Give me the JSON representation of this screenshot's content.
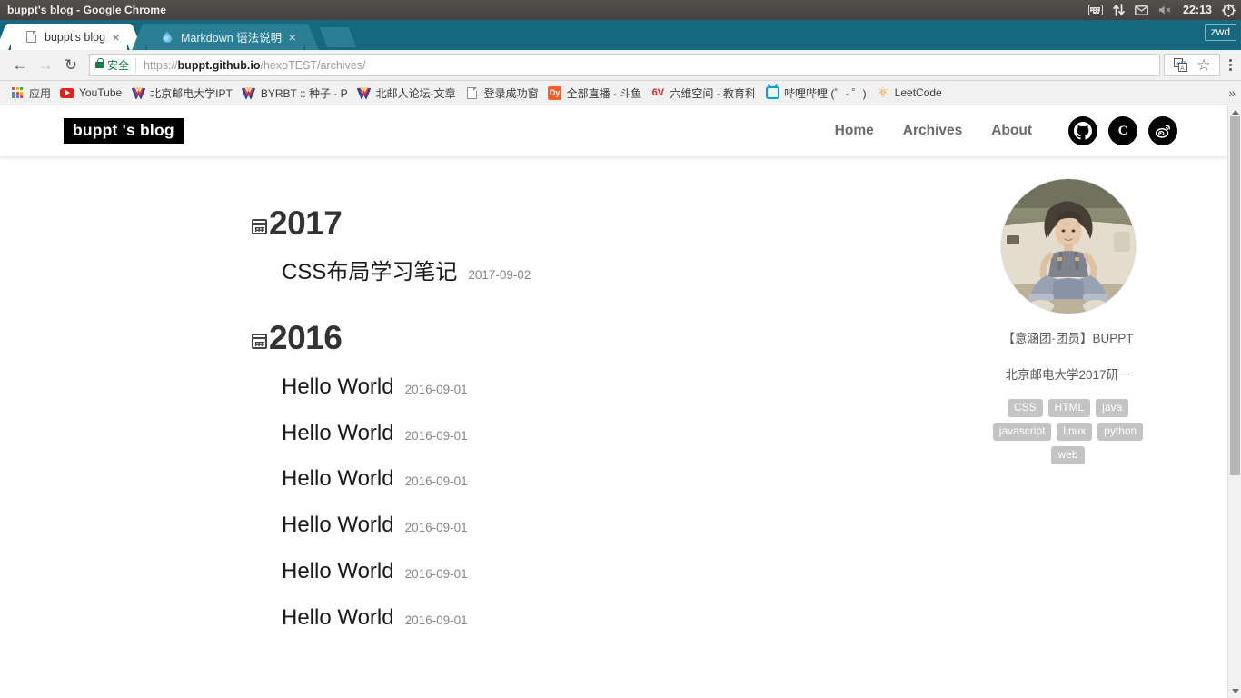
{
  "window": {
    "title": "buppt's blog - Google Chrome",
    "tray": {
      "keyboard_icon": "keyboard-icon",
      "network_icon": "network-updown-icon",
      "mail_icon": "mail-icon",
      "volume_icon": "volume-muted-icon",
      "clock": "22:13",
      "power_icon": "power-gear-icon"
    },
    "user_badge": "zwd"
  },
  "tabs": [
    {
      "title": "buppt's blog",
      "favicon": "page-icon",
      "active": true,
      "close_label": "×"
    },
    {
      "title": "Markdown 语法说明",
      "favicon": "water-drop-icon",
      "active": false,
      "close_label": "×"
    }
  ],
  "toolbar": {
    "back_icon": "←",
    "forward_icon": "→",
    "reload_icon": "↻",
    "security_label": "安全",
    "url": {
      "scheme": "https://",
      "host": "buppt.github.io",
      "path": "/hexoTEST/archives/",
      "full": "https://buppt.github.io/hexoTEST/archives/"
    },
    "translate_icon": "translate-icon",
    "bookmark_star": "☆",
    "menu_icon": "three-dot-menu-icon"
  },
  "bookmarks": {
    "items": [
      {
        "label": "应用",
        "icon": "apps-grid-icon"
      },
      {
        "label": "YouTube",
        "icon": "youtube-icon"
      },
      {
        "label": "北京邮电大学IPT",
        "icon": "v-bird-icon"
      },
      {
        "label": "BYRBT :: 种子 - P",
        "icon": "v-bird-icon"
      },
      {
        "label": "北邮人论坛-文章",
        "icon": "v-bird-icon"
      },
      {
        "label": "登录成功窗",
        "icon": "page-icon"
      },
      {
        "label": "全部直播 - 斗鱼",
        "icon": "douyu-icon"
      },
      {
        "label": "六维空间 - 教育科",
        "icon": "liuwei-icon"
      },
      {
        "label": "哔哩哔哩 (゜- ゜)",
        "icon": "bilibili-icon"
      },
      {
        "label": "LeetCode",
        "icon": "leetcode-icon"
      }
    ],
    "overflow_label": "»"
  },
  "site": {
    "logo": "buppt 's blog",
    "nav": [
      {
        "label": "Home"
      },
      {
        "label": "Archives"
      },
      {
        "label": "About"
      }
    ],
    "socials": [
      {
        "name": "github-icon"
      },
      {
        "name": "csdn-icon",
        "glyph": "C"
      },
      {
        "name": "weibo-icon"
      }
    ]
  },
  "archives": {
    "years": [
      {
        "year": "2017",
        "posts": [
          {
            "title": "CSS布局学习笔记",
            "date": "2017-09-02"
          }
        ]
      },
      {
        "year": "2016",
        "posts": [
          {
            "title": "Hello World",
            "date": "2016-09-01"
          },
          {
            "title": "Hello World",
            "date": "2016-09-01"
          },
          {
            "title": "Hello World",
            "date": "2016-09-01"
          },
          {
            "title": "Hello World",
            "date": "2016-09-01"
          },
          {
            "title": "Hello World",
            "date": "2016-09-01"
          },
          {
            "title": "Hello World",
            "date": "2016-09-01"
          }
        ]
      }
    ]
  },
  "sidebar": {
    "avatar_alt": "author-avatar",
    "author_name": "【意涵团·团员】BUPPT",
    "author_sub": "北京邮电大学2017研一",
    "tags": [
      {
        "label": "CSS"
      },
      {
        "label": "HTML"
      },
      {
        "label": "java"
      },
      {
        "label": "javascript"
      },
      {
        "label": "linux"
      },
      {
        "label": "python"
      },
      {
        "label": "web"
      }
    ]
  },
  "colors": {
    "chrome_tabstrip": "#14697f",
    "unity_bar": "#4c4843",
    "secure_green": "#0a8043",
    "tag_gray": "#c4c4c4",
    "logo_bg": "#000000"
  }
}
